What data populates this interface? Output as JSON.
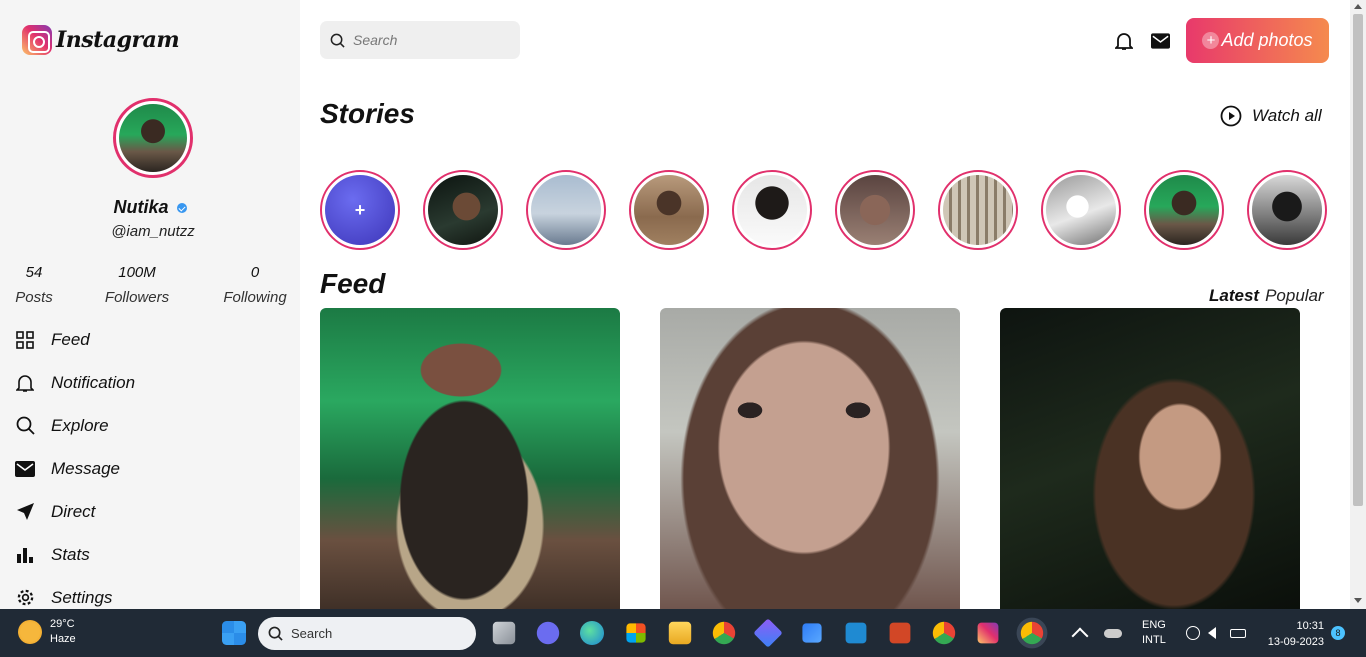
{
  "app": {
    "logo_text": "Instagram"
  },
  "profile": {
    "name": "Nutika",
    "handle": "@iam_nutzz",
    "stats": [
      {
        "value": "54",
        "label": "Posts"
      },
      {
        "value": "100M",
        "label": "Followers"
      },
      {
        "value": "0",
        "label": "Following"
      }
    ]
  },
  "nav": [
    {
      "label": "Feed",
      "icon": "grid-icon"
    },
    {
      "label": "Notification",
      "icon": "bell-icon"
    },
    {
      "label": "Explore",
      "icon": "search-icon"
    },
    {
      "label": "Message",
      "icon": "mail-icon"
    },
    {
      "label": "Direct",
      "icon": "send-icon"
    },
    {
      "label": "Stats",
      "icon": "bar-chart-icon"
    },
    {
      "label": "Settings",
      "icon": "gear-icon"
    }
  ],
  "header": {
    "search_placeholder": "Search",
    "add_photos_label": "Add photos"
  },
  "stories": {
    "title": "Stories",
    "watch_all_label": "Watch all",
    "add_symbol": "+"
  },
  "feed": {
    "title": "Feed",
    "tabs": [
      "Latest",
      "Popular"
    ]
  },
  "colors": {
    "accent": "#e1306c",
    "button_gradient_start": "#e8396b",
    "button_gradient_end": "#f58a4e",
    "verified": "#3897f0"
  },
  "taskbar": {
    "weather_temp": "29°C",
    "weather_desc": "Haze",
    "search_placeholder": "Search",
    "language_1": "ENG",
    "language_2": "INTL",
    "time": "10:31",
    "date": "13-09-2023",
    "notification_count": "8"
  }
}
